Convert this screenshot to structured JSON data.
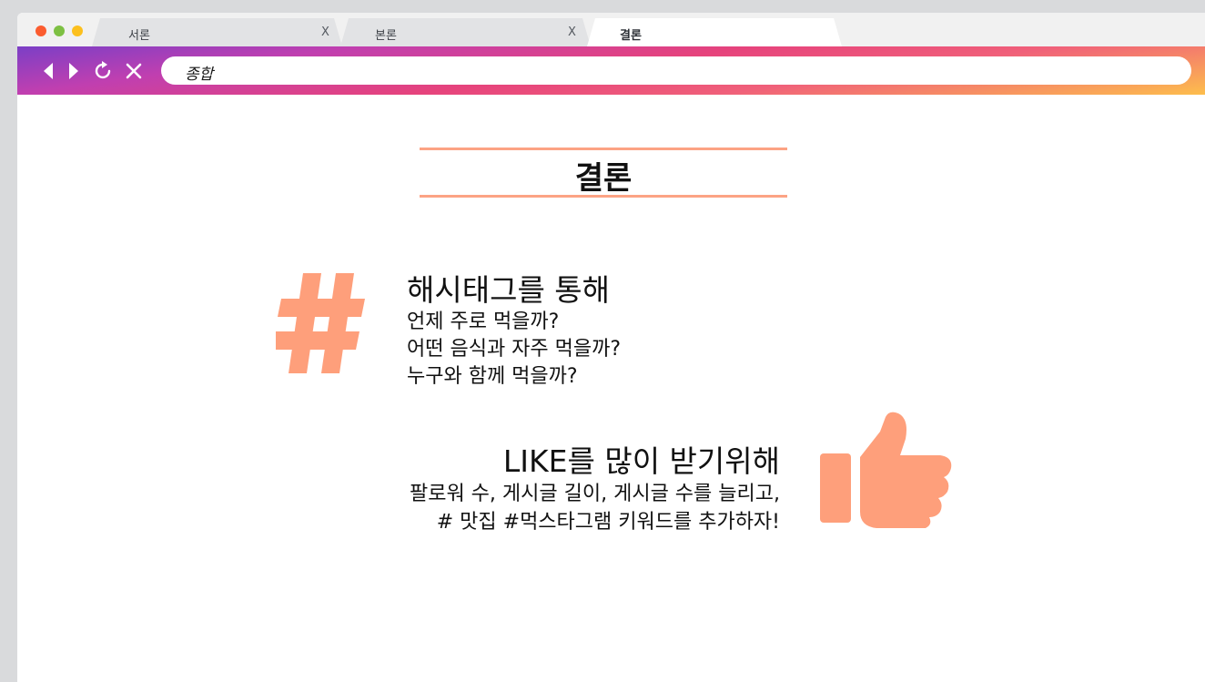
{
  "window": {
    "tabs": [
      {
        "label": "서론",
        "close": "X"
      },
      {
        "label": "본론",
        "close": "X"
      },
      {
        "label": "결론"
      }
    ]
  },
  "toolbar": {
    "address": "종합",
    "icons": [
      "back-arrow-icon",
      "forward-arrow-icon",
      "reload-icon",
      "close-icon"
    ]
  },
  "page": {
    "title": "결론",
    "section1": {
      "icon": "hashtag-icon",
      "heading": "해시태그를 통해",
      "lines": [
        "언제 주로 먹을까?",
        "어떤 음식과 자주 먹을까?",
        "누구와 함께 먹을까?"
      ]
    },
    "section2": {
      "icon": "thumbs-up-icon",
      "heading": "LIKE를 많이 받기위해",
      "lines": [
        "팔로워 수, 게시글 길이, 게시글 수를 늘리고,",
        "# 맛집 #먹스타그램 키워드를 추가하자!"
      ]
    }
  },
  "colors": {
    "accent": "#fca384",
    "icon": "#fe9f7b",
    "gradient_start": "#7b3fc6",
    "gradient_end": "#fdbe4c"
  }
}
